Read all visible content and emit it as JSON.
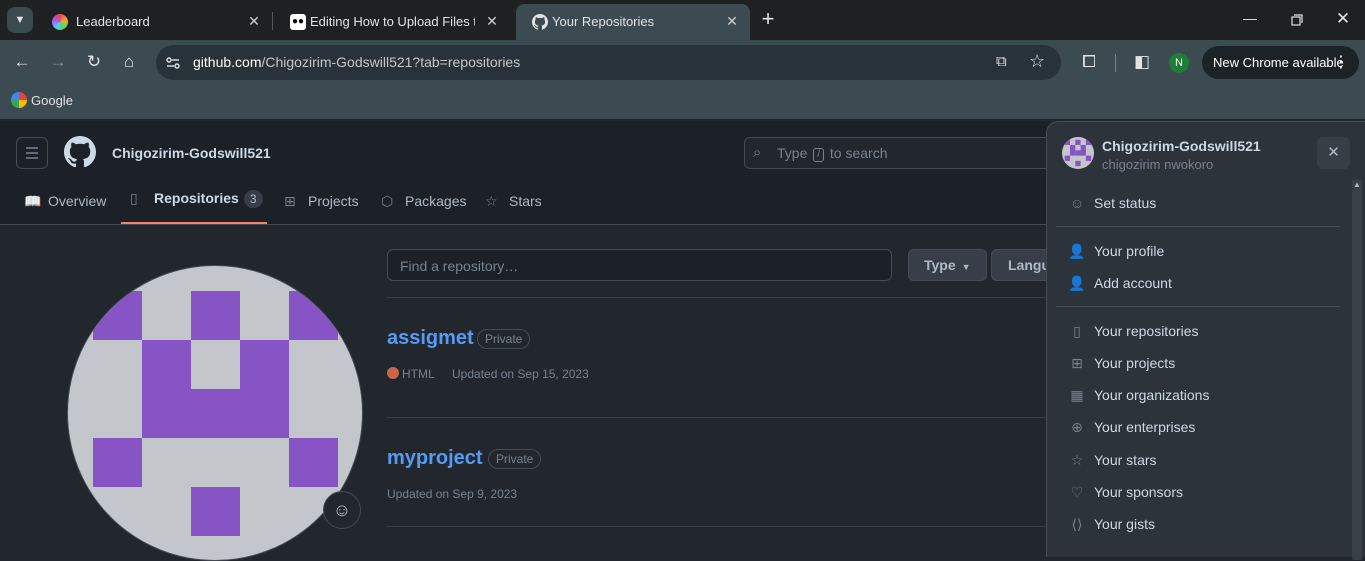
{
  "browser": {
    "tabs": [
      {
        "title": "Leaderboard",
        "icon": "colorful-logo-icon"
      },
      {
        "title": "Editing How to Upload Files to G",
        "icon": "medium-logo-icon"
      },
      {
        "title": "Your Repositories",
        "icon": "github-logo-icon"
      }
    ],
    "new_tab": "+",
    "url_domain": "github.com",
    "url_path": "/Chigozirim-Godswill521?tab=repositories",
    "profile_initial": "N",
    "new_chrome_label": "New Chrome available",
    "bookmarks": [
      {
        "label": "Google"
      }
    ]
  },
  "github": {
    "username": "Chigozirim-Godswill521",
    "search_placeholder_pre": "Type",
    "search_key": "/",
    "search_placeholder_post": "to search",
    "tabs": [
      {
        "label": "Overview"
      },
      {
        "label": "Repositories",
        "count": "3"
      },
      {
        "label": "Projects"
      },
      {
        "label": "Packages"
      },
      {
        "label": "Stars"
      }
    ],
    "find_placeholder": "Find a repository…",
    "type_button": "Type",
    "language_button": "Langu",
    "repos": [
      {
        "name": "assigmet",
        "visibility": "Private",
        "language": "HTML",
        "language_color": "#e34c26",
        "updated": "Updated on Sep 15, 2023"
      },
      {
        "name": "myproject",
        "visibility": "Private",
        "updated": "Updated on Sep 9, 2023"
      }
    ]
  },
  "menu": {
    "username": "Chigozirim-Godswill521",
    "fullname": "chigozirim nwokoro",
    "items": [
      {
        "label": "Set status",
        "icon": "smiley-icon"
      },
      {
        "label": "Your profile",
        "icon": "person-icon"
      },
      {
        "label": "Add account",
        "icon": "person-add-icon"
      },
      {
        "label": "Your repositories",
        "icon": "repo-icon"
      },
      {
        "label": "Your projects",
        "icon": "table-icon"
      },
      {
        "label": "Your organizations",
        "icon": "organization-icon"
      },
      {
        "label": "Your enterprises",
        "icon": "globe-icon"
      },
      {
        "label": "Your stars",
        "icon": "star-icon"
      },
      {
        "label": "Your sponsors",
        "icon": "heart-icon"
      },
      {
        "label": "Your gists",
        "icon": "code-square-icon"
      }
    ]
  },
  "colors": {
    "avatar_purple": "#8654c5",
    "avatar_bg": "#c3c6cb",
    "accent_orange": "#f78166",
    "link_blue": "#539bf5"
  }
}
